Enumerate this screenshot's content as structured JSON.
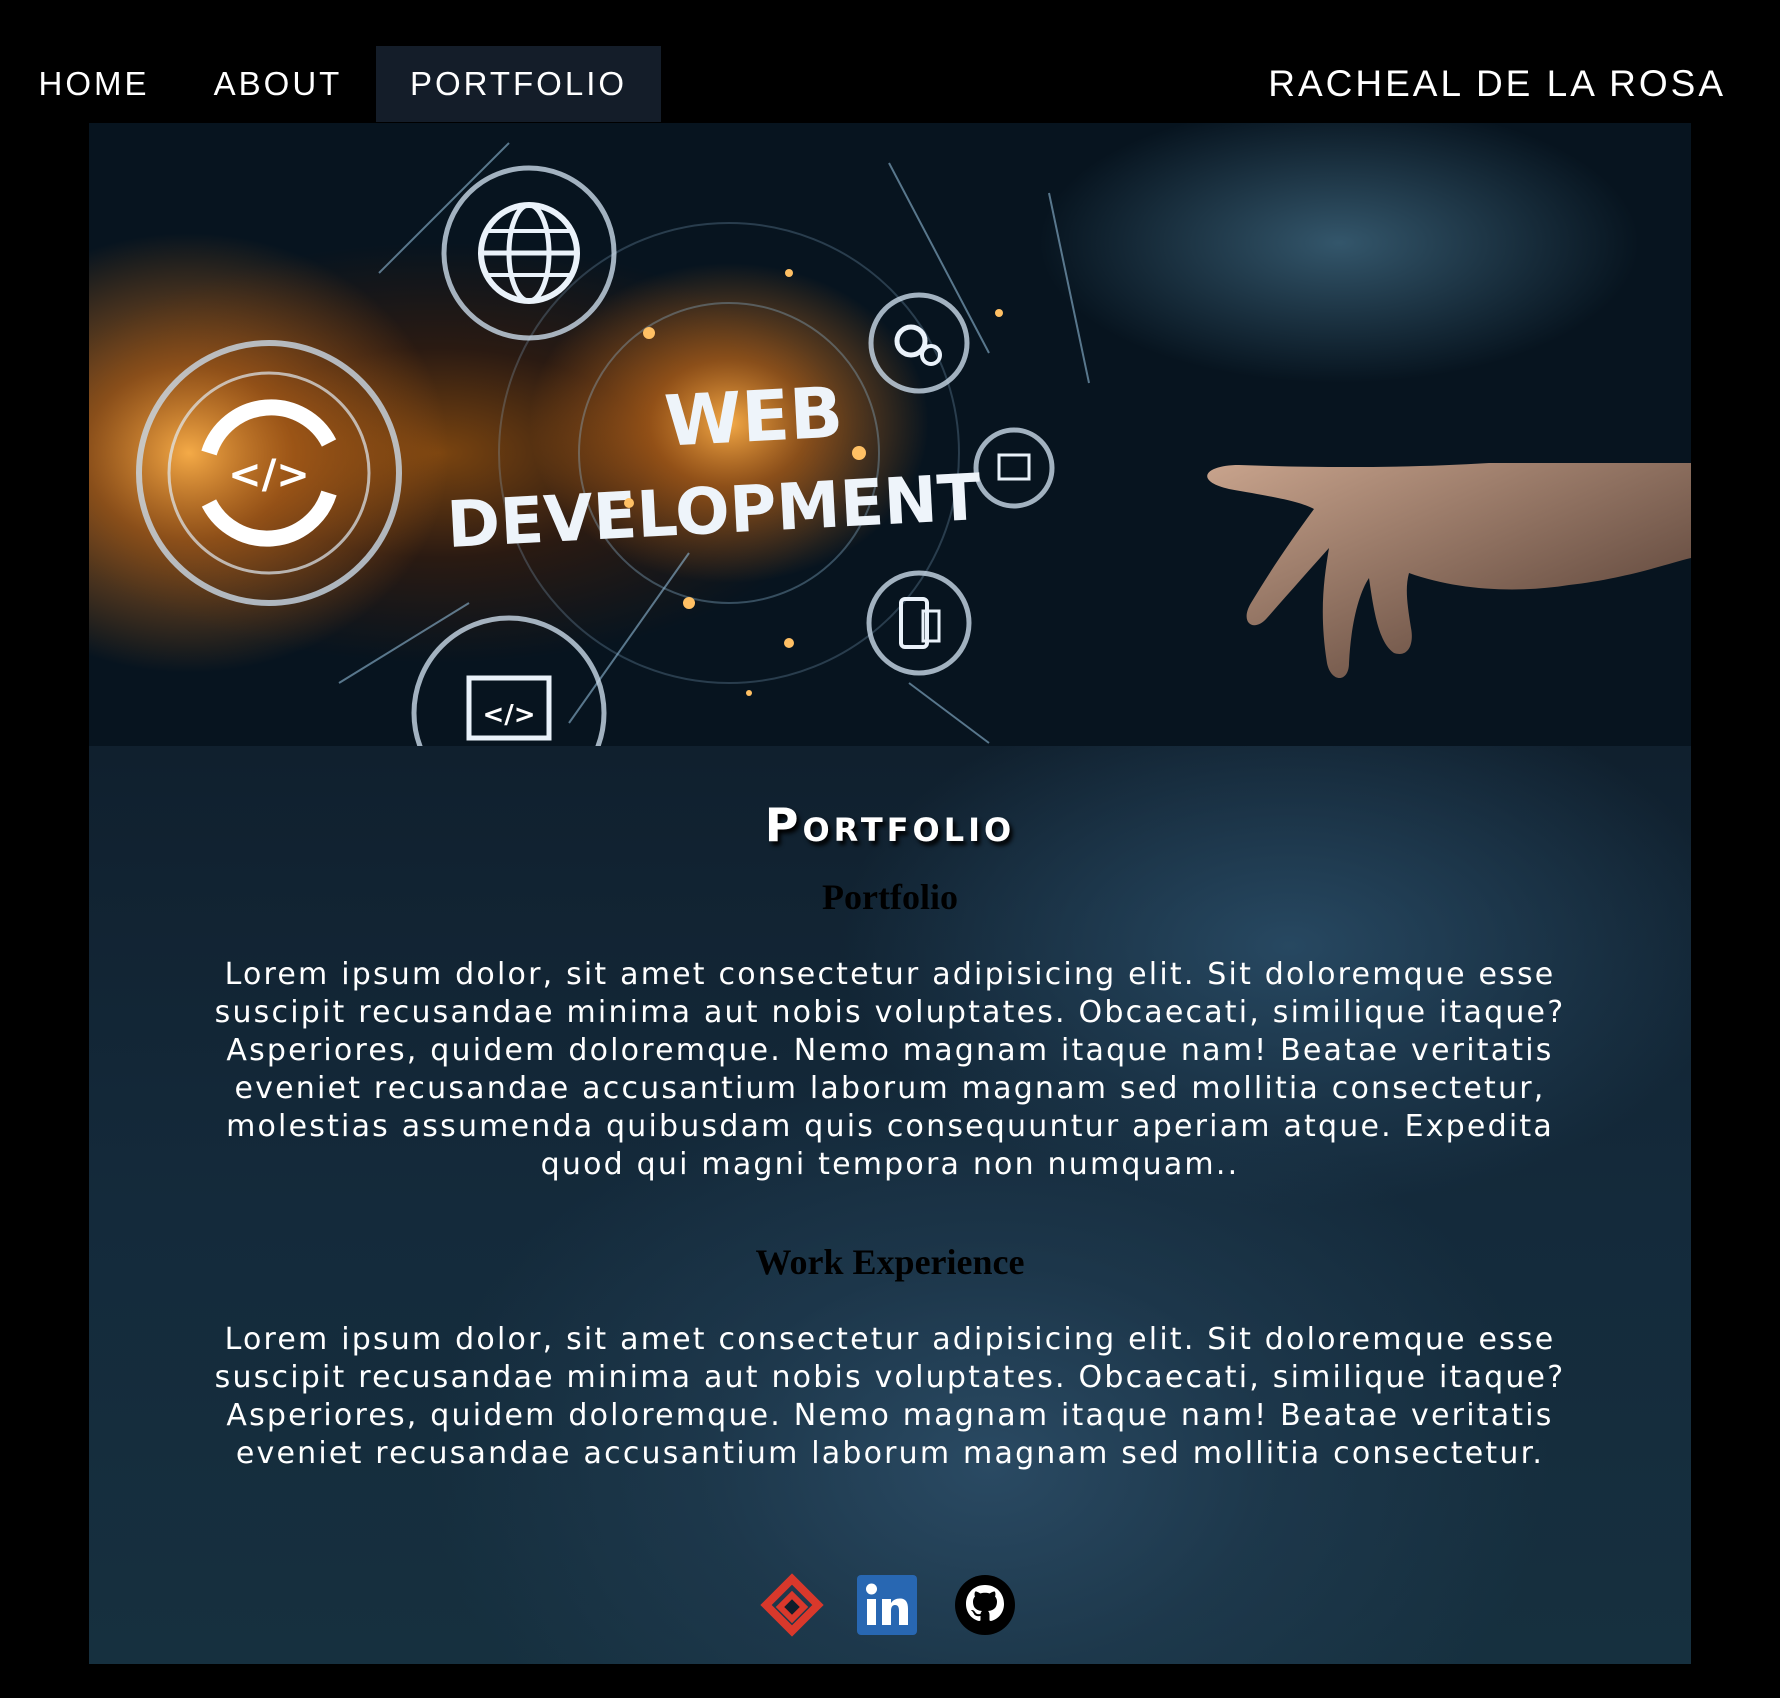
{
  "nav": {
    "home": "HOME",
    "about": "ABOUT",
    "portfolio": "PORTFOLIO",
    "brand": "RACHEAL DE LA ROSA"
  },
  "hero": {
    "image_text_line1": "WEB",
    "image_text_line2": "DEVELOPMENT"
  },
  "main": {
    "title": "Portfolio",
    "portfolio_heading": "Portfolio",
    "portfolio_text": "Lorem ipsum dolor, sit amet consectetur adipisicing elit. Sit doloremque esse suscipit recusandae minima aut nobis voluptates. Obcaecati, similique itaque? Asperiores, quidem doloremque. Nemo magnam itaque nam! Beatae veritatis eveniet recusandae accusantium laborum magnam sed mollitia consectetur, molestias assumenda quibusdam quis consequuntur aperiam atque. Expedita quod qui magni tempora non numquam..",
    "experience_heading": "Work Experience",
    "experience_text": "Lorem ipsum dolor, sit amet consectetur adipisicing elit. Sit doloremque esse suscipit recusandae minima aut nobis voluptates. Obcaecati, similique itaque? Asperiores, quidem doloremque. Nemo magnam itaque nam! Beatae veritatis eveniet recusandae accusantium laborum magnam sed mollitia consectetur."
  },
  "social": {
    "icons": [
      "gitkraken-icon",
      "linkedin-icon",
      "github-icon"
    ]
  },
  "colors": {
    "nav_active_bg": "#141d29",
    "content_bg": "#16303f",
    "linkedin_blue": "#2867b2",
    "gitkraken_red": "#d9382b"
  }
}
